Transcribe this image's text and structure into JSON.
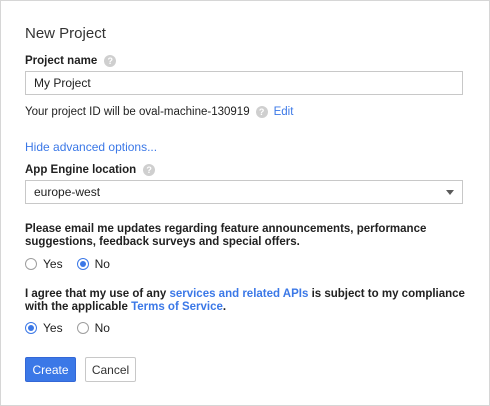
{
  "dialog": {
    "title": "New Project"
  },
  "project_name": {
    "label": "Project name",
    "help_glyph": "?",
    "value": "My Project"
  },
  "project_id": {
    "text": "Your project ID will be oval-machine-130919",
    "help_glyph": "?",
    "edit_label": "Edit"
  },
  "advanced": {
    "toggle_label": "Hide advanced options..."
  },
  "app_engine_location": {
    "label": "App Engine location",
    "help_glyph": "?",
    "selected": "europe-west"
  },
  "email_updates": {
    "question": "Please email me updates regarding feature announcements, performance suggestions, feedback surveys and special offers.",
    "options": [
      {
        "label": "Yes",
        "checked": false
      },
      {
        "label": "No",
        "checked": true
      }
    ]
  },
  "terms": {
    "text_before": "I agree that my use of any ",
    "link1": "services and related APIs",
    "text_middle": " is subject to my compliance with the applicable ",
    "link2": "Terms of Service",
    "text_after": ".",
    "options": [
      {
        "label": "Yes",
        "checked": true
      },
      {
        "label": "No",
        "checked": false
      }
    ]
  },
  "buttons": {
    "create": "Create",
    "cancel": "Cancel"
  },
  "colors": {
    "accent": "#3b78e7",
    "border": "#c8c8c8",
    "help_icon": "#cfcfcf"
  },
  "icons": {
    "help": "help-circle-icon",
    "dropdown": "caret-down-icon"
  }
}
